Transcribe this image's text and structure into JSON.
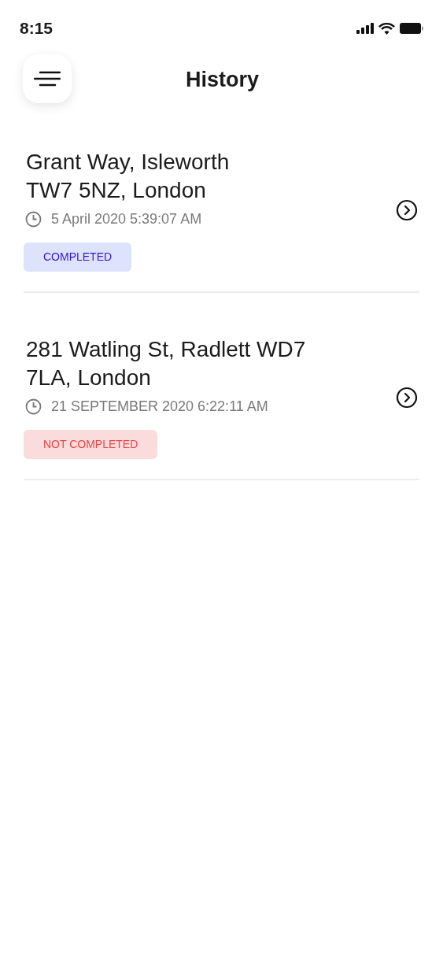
{
  "status_bar": {
    "time": "8:15"
  },
  "header": {
    "title": "History"
  },
  "trips": [
    {
      "address_lines": [
        "Grant Way, Isleworth",
        "TW7 5NZ, London"
      ],
      "datetime": "5 April 2020 5:39:07 AM",
      "status": {
        "kind": "completed",
        "label": "COMPLETED"
      }
    },
    {
      "address_lines": [
        "281 Watling St, Radlett WD7",
        "7LA, London"
      ],
      "datetime": "21 SEPTEMBER 2020 6:22:11 AM",
      "status": {
        "kind": "not_completed",
        "label": "NOT COMPLETED"
      }
    }
  ]
}
